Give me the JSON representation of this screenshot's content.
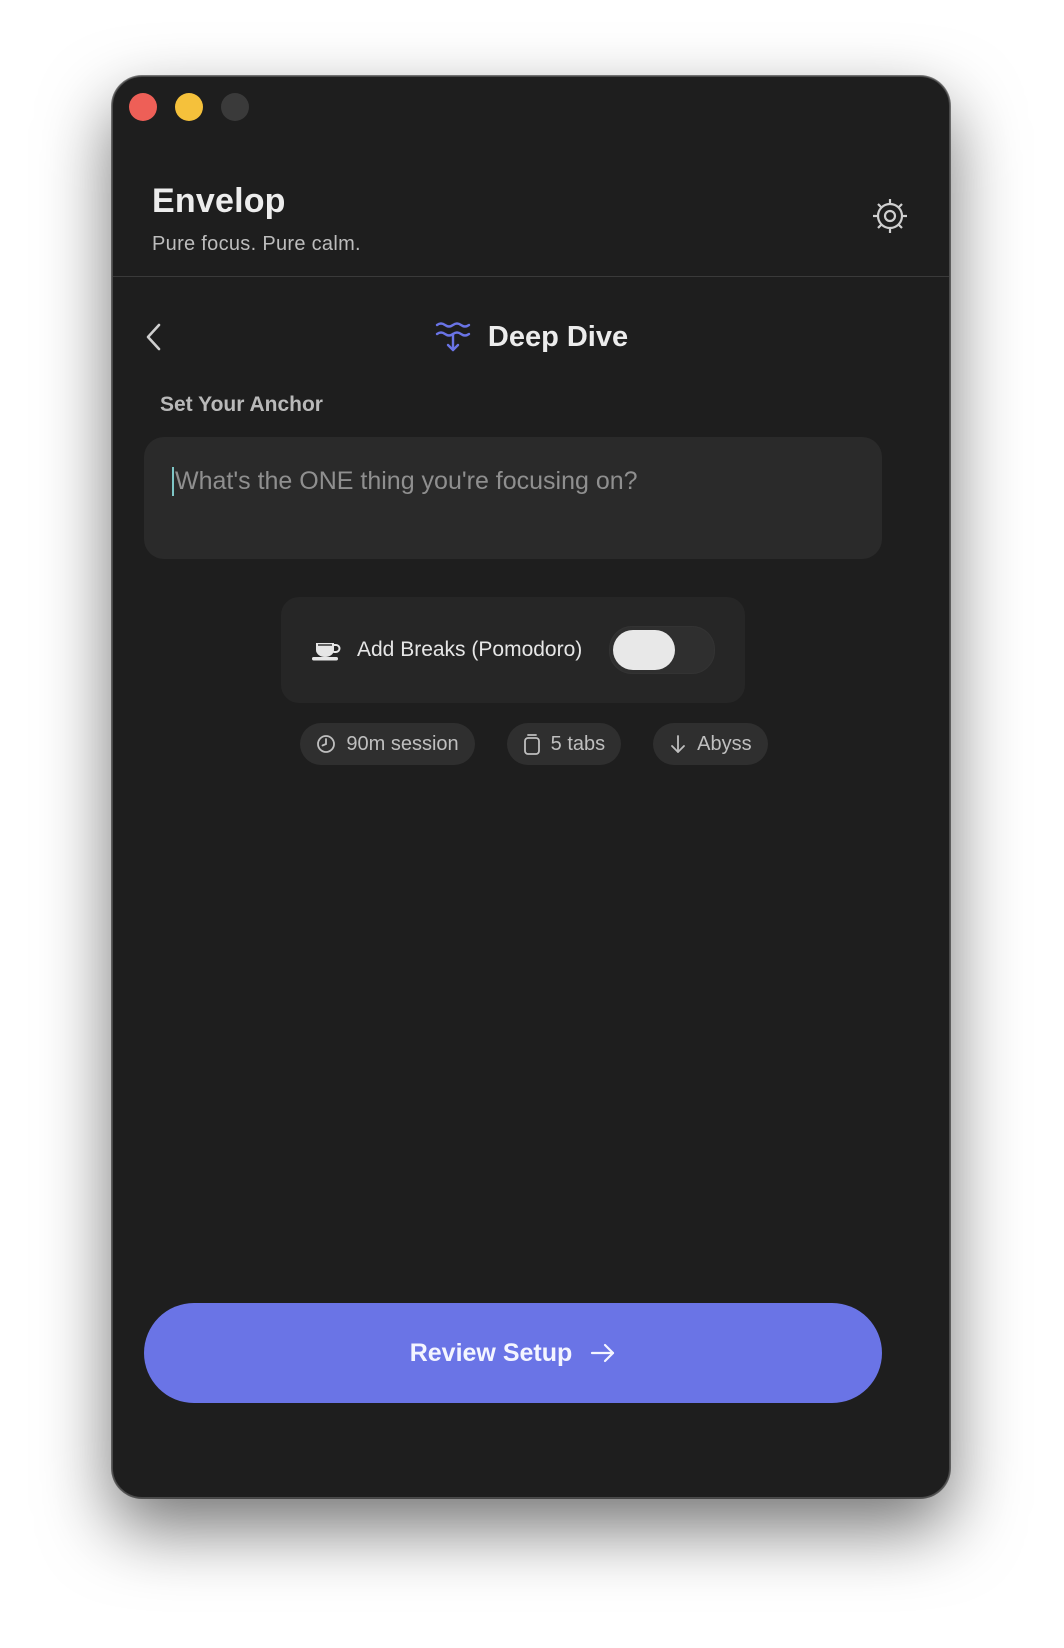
{
  "app": {
    "title": "Envelop",
    "subtitle": "Pure focus. Pure calm."
  },
  "mode": {
    "title": "Deep Dive",
    "icon": "waves-down-icon",
    "accent": "#6a74e6"
  },
  "anchor": {
    "label": "Set Your Anchor",
    "placeholder": "What's the ONE thing you're focusing on?",
    "value": ""
  },
  "breaks": {
    "label": "Add Breaks (Pomodoro)",
    "icon": "coffee-cup-icon",
    "enabled": false
  },
  "chips": [
    {
      "icon": "clock-icon",
      "label": "90m session"
    },
    {
      "icon": "tabs-icon",
      "label": "5 tabs"
    },
    {
      "icon": "arrow-down-icon",
      "label": "Abyss"
    }
  ],
  "cta": {
    "label": "Review Setup",
    "icon": "arrow-right-icon"
  },
  "colors": {
    "window_bg": "#1e1e1e",
    "card_bg": "#2a2a2a",
    "accent": "#6a74e6",
    "close": "#ee5f57",
    "minimize": "#f5c13b"
  }
}
